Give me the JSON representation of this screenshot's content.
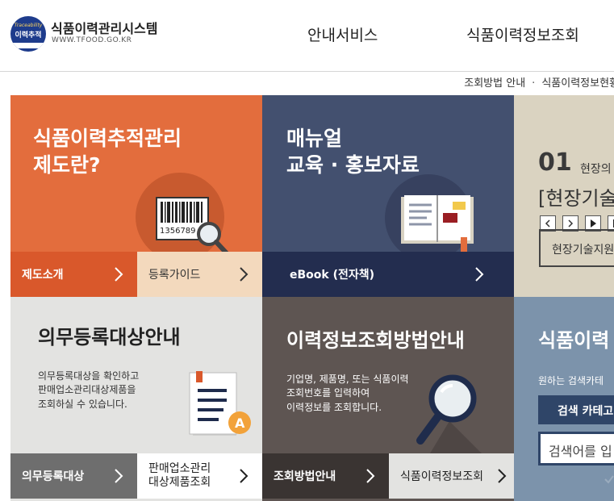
{
  "header": {
    "logo_badge_top": "Traceability",
    "logo_badge_main": "이력추적",
    "title": "식품이력관리시스템",
    "url": "WWW.TFOOD.GO.KR",
    "nav": [
      "안내서비스",
      "식품이력정보조회"
    ]
  },
  "breadcrumb": {
    "items": [
      "조회방법 안내",
      "식품이력정보현황"
    ],
    "separator": "·"
  },
  "tiles": {
    "system": {
      "title_line1": "식품이력추적관리",
      "title_line2": "제도란?",
      "barcode_number": "1356789",
      "bar_left": "제도소개",
      "bar_right": "등록가이드"
    },
    "manual": {
      "title_line1": "매뉴얼",
      "title_line2": "교육 · 홍보자료",
      "bar": "eBook (전자책)"
    },
    "field": {
      "number": "01",
      "caption": "현장의",
      "bracket_title": "[현장기술",
      "button": "현장기술지원"
    },
    "mandatory": {
      "title": "의무등록대상안내",
      "desc_line1": "의무등록대상을 확인하고",
      "desc_line2": "판매업소관리대상제품을",
      "desc_line3": "조회하실 수 있습니다.",
      "bar_left": "의무등록대상",
      "bar_right_line1": "판매업소관리",
      "bar_right_line2": "대상제품조회"
    },
    "lookup": {
      "title": "이력정보조회방법안내",
      "desc_line1": "기업명, 제품명, 또는 식품이력",
      "desc_line2": "조회번호를 입력하여",
      "desc_line3": "이력정보를 조회합니다.",
      "bar_left": "조회방법안내",
      "bar_right": "식품이력정보조회"
    },
    "search": {
      "title": "식품이력",
      "desc": "원하는 검색카테",
      "category_button": "검색 카테고",
      "input_placeholder": "검색어를 입"
    }
  },
  "colors": {
    "orange": "#e36d3d",
    "orange_dark": "#d9582b",
    "peach": "#f3d9bd",
    "navy": "#43506f",
    "navy_dark": "#232d4f",
    "beige": "#dad3c1",
    "light_gray": "#e3e3e1",
    "gray_dark": "#6e6e6e",
    "brown": "#5e5552",
    "steel": "#7c93ab",
    "dark_blue": "#2f4568"
  }
}
